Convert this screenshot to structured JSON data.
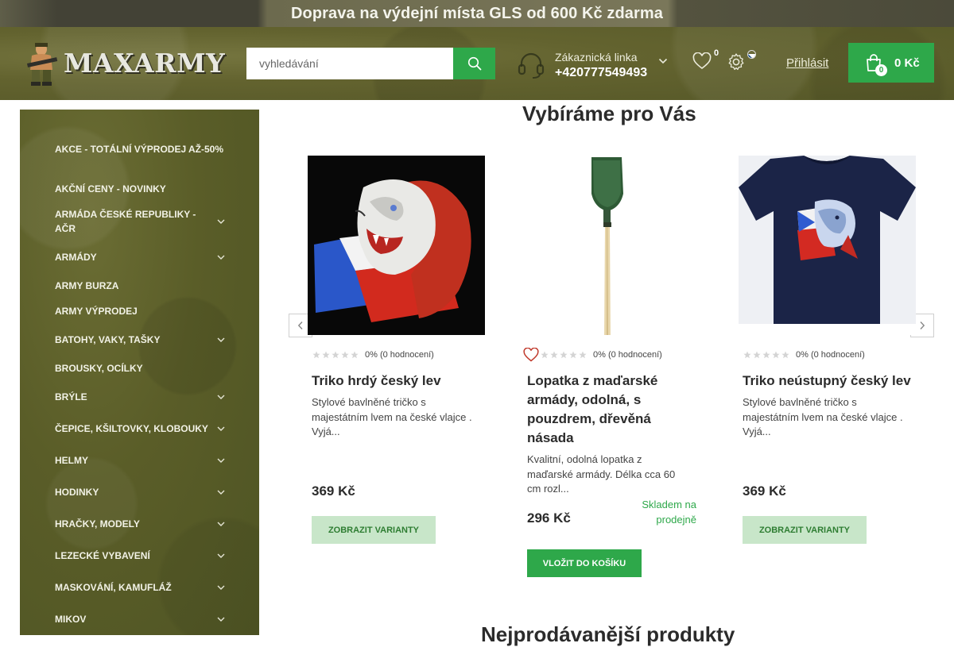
{
  "banner": {
    "text": "Doprava na výdejní místa GLS od 600 Kč zdarma"
  },
  "header": {
    "logo_text": "MAXARMY",
    "search": {
      "placeholder": "vyhledávání",
      "value": ""
    },
    "support": {
      "label": "Zákaznická linka",
      "phone": "+420777549493"
    },
    "wishlist_count": "0",
    "login_label": "Přihlásit",
    "cart": {
      "count": "0",
      "amount": "0 Kč"
    }
  },
  "sidebar": {
    "items": [
      {
        "label": "AKCE - TOTÁLNÍ VÝPRODEJ AŽ-50%",
        "has_submenu": false
      },
      {
        "label": "AKČNÍ CENY - NOVINKY",
        "has_submenu": false
      },
      {
        "label": "ARMÁDA ČESKÉ REPUBLIKY - AČR",
        "has_submenu": true
      },
      {
        "label": "ARMÁDY",
        "has_submenu": true
      },
      {
        "label": "ARMY BURZA",
        "has_submenu": false
      },
      {
        "label": "ARMY VÝPRODEJ",
        "has_submenu": false
      },
      {
        "label": "BATOHY, VAKY, TAŠKY",
        "has_submenu": true
      },
      {
        "label": "BROUSKY, OCÍLKY",
        "has_submenu": false
      },
      {
        "label": "BRÝLE",
        "has_submenu": true
      },
      {
        "label": "ČEPICE, KŠILTOVKY, KLOBOUKY",
        "has_submenu": true
      },
      {
        "label": "HELMY",
        "has_submenu": true
      },
      {
        "label": "HODINKY",
        "has_submenu": true
      },
      {
        "label": "HRAČKY, MODELY",
        "has_submenu": true
      },
      {
        "label": "LEZECKÉ VYBAVENÍ",
        "has_submenu": true
      },
      {
        "label": "MASKOVÁNÍ, KAMUFLÁŽ",
        "has_submenu": true
      },
      {
        "label": "MIKOV",
        "has_submenu": true
      }
    ]
  },
  "main": {
    "title": "Vybíráme pro Vás",
    "bottom_title": "Nejprodávanější produkty",
    "products": [
      {
        "name": "Triko hrdý český lev",
        "rating_text": "0% (0 hodnocení)",
        "description": "Stylové bavlněné tričko s majestátním lvem na české vlajce . Vyjá...",
        "price": "369 Kč",
        "stock": "",
        "button": "ZOBRAZIT VARIANTY",
        "image": "lion-flag-print-image"
      },
      {
        "name": "Lopatka z maďarské armády, odolná, s pouzdrem, dřevěná násada",
        "rating_text": "0% (0 hodnocení)",
        "description": "Kvalitní, odolná lopatka z maďarské armády. Délka cca 60 cm rozl...",
        "price": "296 Kč",
        "stock": "Skladem na prodejně",
        "button": "VLOŽIT DO KOŠÍKU",
        "image": "shovel-image"
      },
      {
        "name": "Triko neústupný český lev",
        "rating_text": "0% (0 hodnocení)",
        "description": "Stylové bavlněné tričko s majestátním lvem na české vlajce . Vyjá...",
        "price": "369 Kč",
        "stock": "",
        "button": "ZOBRAZIT VARIANTY",
        "image": "navy-tshirt-image"
      }
    ]
  },
  "colors": {
    "accent_green": "#2ea84a",
    "light_green": "#c8e6c9",
    "camo": "#5a5d28"
  }
}
